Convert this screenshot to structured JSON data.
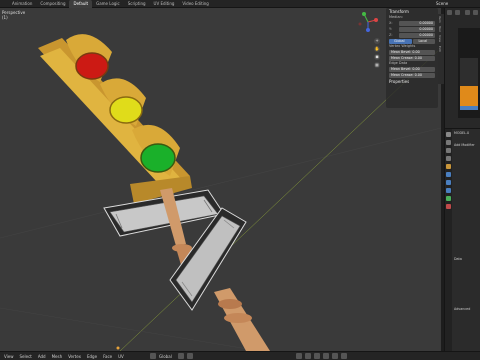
{
  "app": {
    "workspace_tabs": [
      "Animation",
      "Compositing",
      "Default",
      "Game Logic",
      "Scripting",
      "UV Editing",
      "Video Editing"
    ],
    "active_tab": "Default",
    "scene_name": "Scene"
  },
  "viewport": {
    "info_line1": "Perspective",
    "info_line2": "(1)"
  },
  "npanel": {
    "section_transform": "Transform",
    "median_label": "Median:",
    "x_label": "X:",
    "x_value": "0.00000",
    "y_label": "Y:",
    "y_value": "0.00000",
    "z_label": "Z:",
    "z_value": "0.00000",
    "global_label": "Global",
    "local_label": "Local",
    "vertex_weights_label": "Vertex Weights",
    "mean_bevel_label": "Mean Bevel:",
    "mean_bevel_value": "0.00",
    "mean_crease_label": "Mean Crease:",
    "mean_crease_value": "0.00",
    "edge_data_label": "Edge Data",
    "edge_bevel_label": "Mean Bevel:",
    "edge_bevel_value": "0.00",
    "edge_crease_label": "Mean Crease:",
    "edge_crease_value": "0.00",
    "properties_label": "Properties",
    "side_tabs": [
      "Item",
      "Tool",
      "View",
      "Edit"
    ]
  },
  "properties": {
    "object_name": "MODEL.0",
    "add_modifier": "Add Modifier",
    "data_label": "Data",
    "advanced_label": "Advanced"
  },
  "bottombar": {
    "menus": [
      "View",
      "Select",
      "Add",
      "Mesh",
      "Vertex",
      "Edge",
      "Face",
      "UV"
    ],
    "pivot_label": "Global"
  },
  "colors": {
    "viewport_bg": "#3a3a3a",
    "housing": "#e0b440",
    "red_lamp": "#cc1a14",
    "yellow_lamp": "#e0dc1a",
    "green_lamp": "#1ab02a",
    "sign_bg": "#c8c8c8",
    "pole": "#d09a6a",
    "accent": "#4772b3"
  },
  "icons": [
    "sphere-icon",
    "camera-icon",
    "hand-icon",
    "zoom-icon",
    "grid-icon"
  ]
}
